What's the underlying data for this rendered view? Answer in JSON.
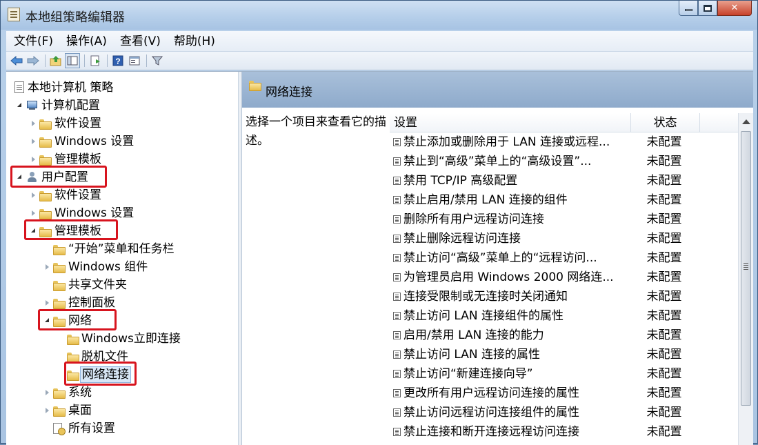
{
  "window": {
    "title": "本地组策略编辑器",
    "controls": {
      "minimize": "minimize-icon",
      "maximize": "maximize-icon",
      "close": "close-icon"
    }
  },
  "menu": {
    "items": [
      {
        "label": "文件(F)"
      },
      {
        "label": "操作(A)"
      },
      {
        "label": "查看(V)"
      },
      {
        "label": "帮助(H)"
      }
    ]
  },
  "toolbar": {
    "icons": [
      "back-arrow-icon",
      "forward-arrow-icon",
      "up-folder-icon",
      "show-hide-tree-icon",
      "export-list-icon",
      "help-icon",
      "properties-icon",
      "filter-icon"
    ]
  },
  "tree": {
    "root": "本地计算机 策略",
    "computer_config": "计算机配置",
    "cc_software": "软件设置",
    "cc_windows": "Windows 设置",
    "cc_admin": "管理模板",
    "user_config": "用户配置",
    "uc_software": "软件设置",
    "uc_windows": "Windows 设置",
    "uc_admin": "管理模板",
    "start_menu": "“开始”菜单和任务栏",
    "windows_components": "Windows 组件",
    "shared_folders": "共享文件夹",
    "control_panel": "控制面板",
    "network": "网络",
    "windows_connect_now": "Windows立即连接",
    "offline_files": "脱机文件",
    "network_connections": "网络连接",
    "system": "系统",
    "desktop": "桌面",
    "all_settings": "所有设置"
  },
  "content": {
    "header_title": "网络连接",
    "description": "选择一个项目来查看它的描述。",
    "columns": {
      "setting": "设置",
      "state": "状态"
    },
    "policies": [
      {
        "name": "禁止添加或删除用于 LAN 连接或远程...",
        "state": "未配置"
      },
      {
        "name": "禁止到“高级”菜单上的“高级设置”...",
        "state": "未配置"
      },
      {
        "name": "禁用 TCP/IP 高级配置",
        "state": "未配置"
      },
      {
        "name": "禁止启用/禁用 LAN 连接的组件",
        "state": "未配置"
      },
      {
        "name": "删除所有用户远程访问连接",
        "state": "未配置"
      },
      {
        "name": "禁止删除远程访问连接",
        "state": "未配置"
      },
      {
        "name": "禁止访问“高级”菜单上的“远程访问...",
        "state": "未配置"
      },
      {
        "name": "为管理员启用 Windows 2000 网络连...",
        "state": "未配置"
      },
      {
        "name": "连接受限制或无连接时关闭通知",
        "state": "未配置"
      },
      {
        "name": "禁止访问 LAN 连接组件的属性",
        "state": "未配置"
      },
      {
        "name": "启用/禁用 LAN 连接的能力",
        "state": "未配置"
      },
      {
        "name": "禁止访问 LAN 连接的属性",
        "state": "未配置"
      },
      {
        "name": "禁止访问“新建连接向导”",
        "state": "未配置"
      },
      {
        "name": "更改所有用户远程访问连接的属性",
        "state": "未配置"
      },
      {
        "name": "禁止访问远程访问连接组件的属性",
        "state": "未配置"
      },
      {
        "name": "禁止连接和断开连接远程访问连接",
        "state": "未配置"
      }
    ]
  },
  "colors": {
    "highlight_border": "#d7141e",
    "header_band": "#a9c0da",
    "selection": "#d7e6f6"
  }
}
